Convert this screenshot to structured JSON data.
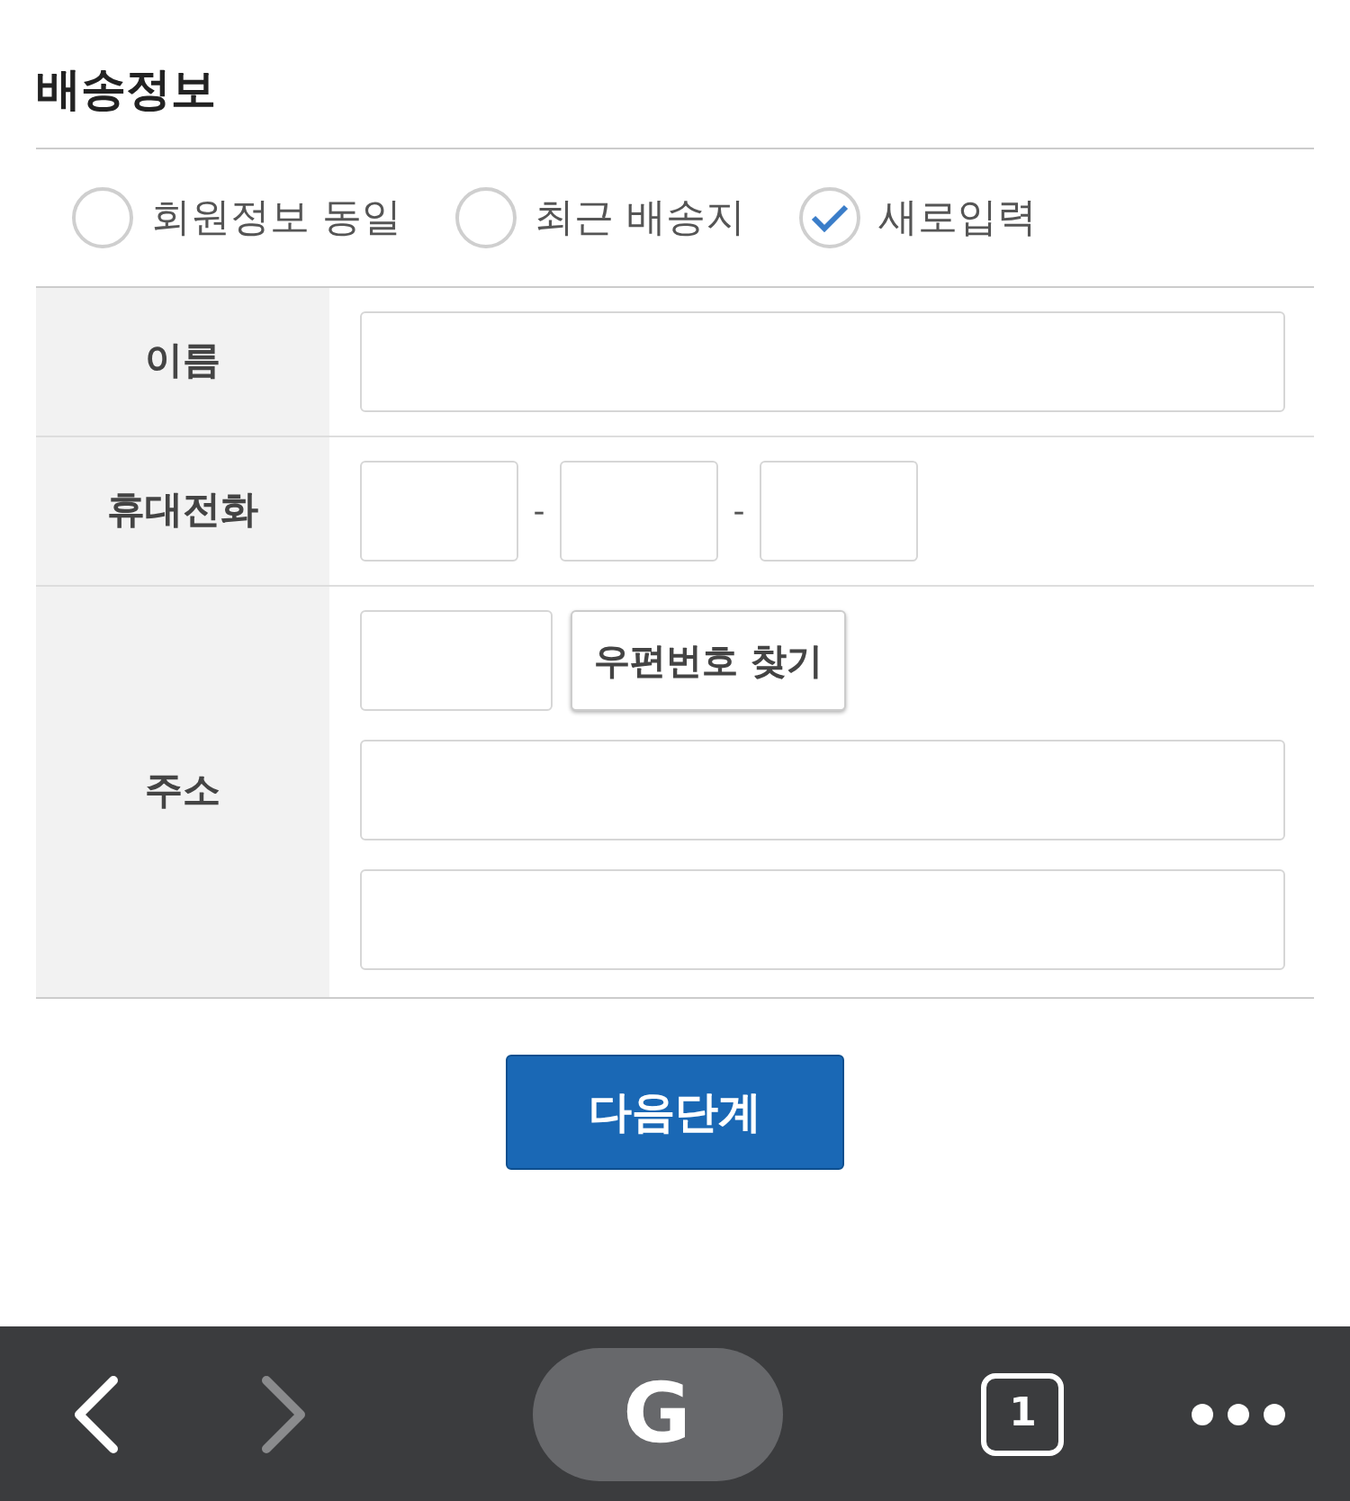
{
  "section": {
    "title": "배송정보"
  },
  "address_options": [
    {
      "label": "회원정보 동일",
      "selected": false
    },
    {
      "label": "최근 배송지",
      "selected": false
    },
    {
      "label": "새로입력",
      "selected": true
    }
  ],
  "form": {
    "rows": [
      {
        "kind": "text",
        "label": "이름"
      },
      {
        "kind": "phone",
        "label": "휴대전화",
        "separators": [
          "-",
          "-"
        ]
      },
      {
        "kind": "address",
        "label": "주소",
        "postcode_button": "우편번호 찾기"
      }
    ]
  },
  "next_button": "다음단계",
  "browser_toolbar": {
    "back": {
      "disabled": false
    },
    "forward": {
      "disabled": true
    },
    "home_label": "G",
    "tab_count": "1"
  }
}
